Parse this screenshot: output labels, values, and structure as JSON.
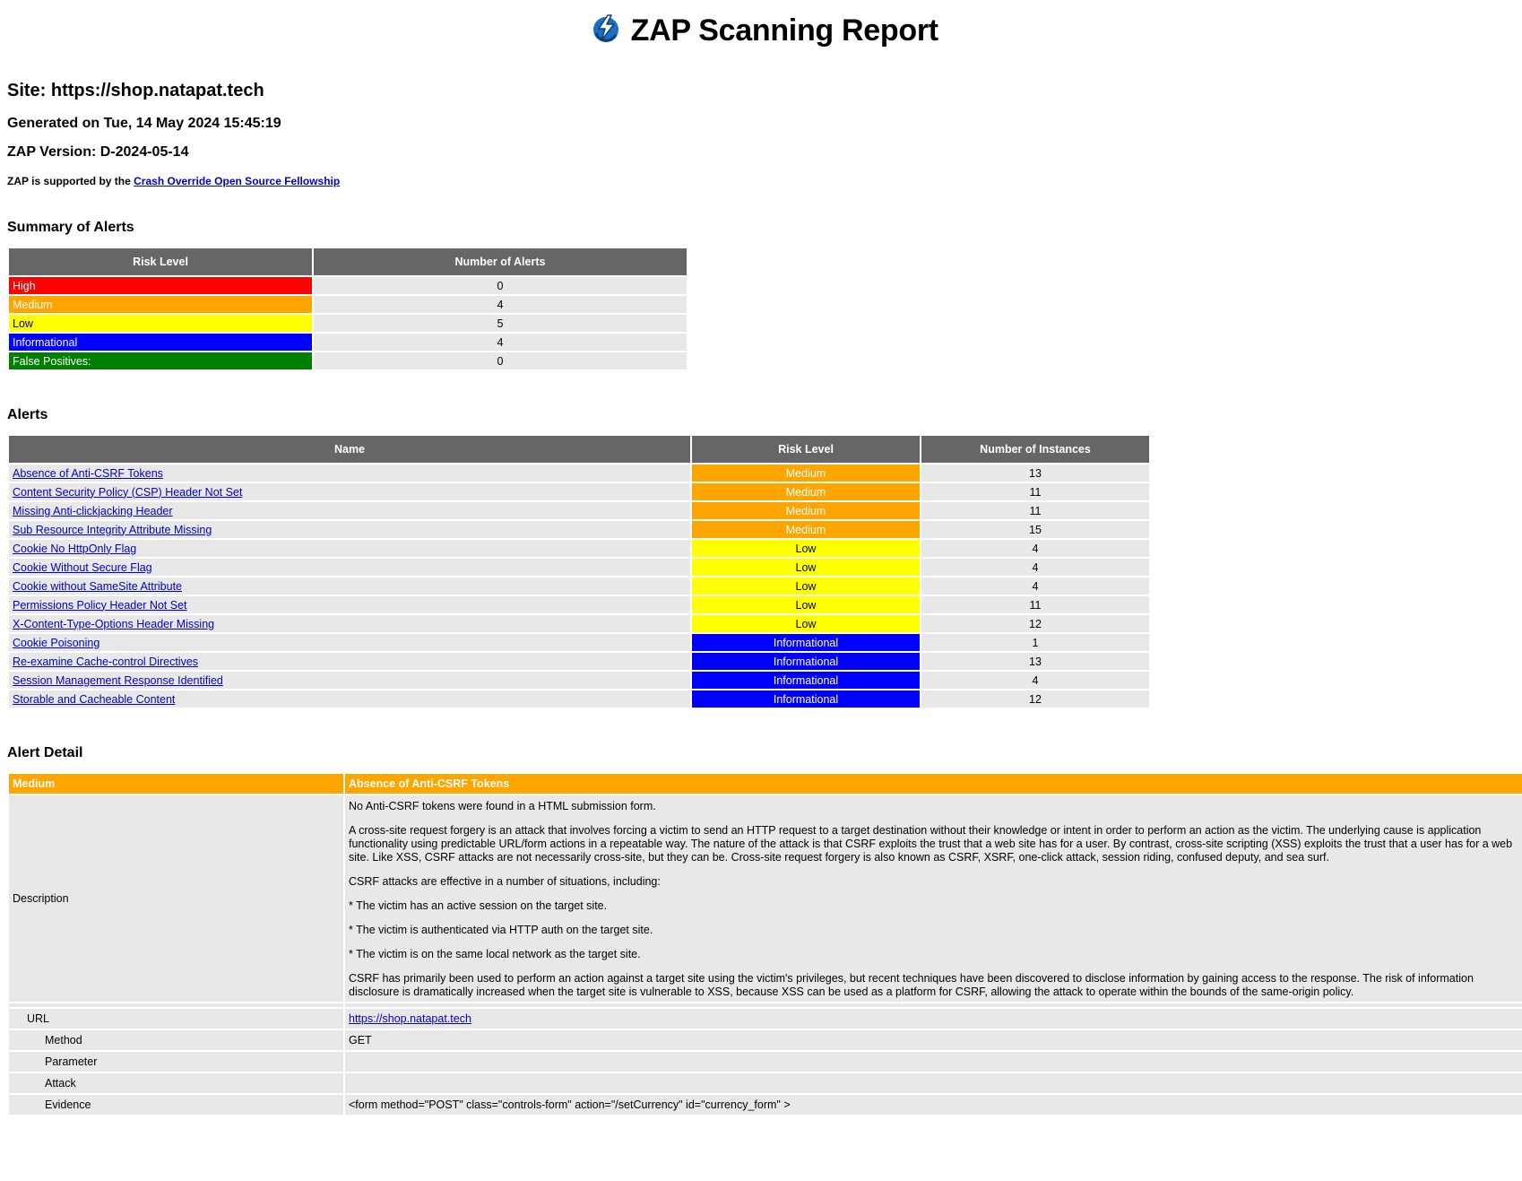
{
  "report": {
    "title": "ZAP Scanning Report",
    "site": "Site: https://shop.natapat.tech",
    "generated": "Generated on Tue, 14 May 2024 15:45:19",
    "version": "ZAP Version: D-2024-05-14",
    "support_prefix": "ZAP is supported by the",
    "support_link": "Crash Override Open Source Fellowship"
  },
  "colors": {
    "header_bg": "#666666",
    "cell_bg": "#e8e8e8",
    "high": "#ff0000",
    "medium": "#ffa500",
    "low": "#ffff00",
    "informational": "#0000ff",
    "false_positive": "#008000",
    "link": "#0000cc"
  },
  "summary": {
    "heading": "Summary of Alerts",
    "col_risk": "Risk Level",
    "col_count": "Number of Alerts",
    "rows": [
      {
        "risk": "High",
        "count": "0",
        "cls": "r-high"
      },
      {
        "risk": "Medium",
        "count": "4",
        "cls": "r-medium"
      },
      {
        "risk": "Low",
        "count": "5",
        "cls": "r-low"
      },
      {
        "risk": "Informational",
        "count": "4",
        "cls": "r-info"
      },
      {
        "risk": "False Positives:",
        "count": "0",
        "cls": "r-fp"
      }
    ]
  },
  "alerts": {
    "heading": "Alerts",
    "col_name": "Name",
    "col_risk": "Risk Level",
    "col_instances": "Number of Instances",
    "rows": [
      {
        "name": "Absence of Anti-CSRF Tokens",
        "risk": "Medium",
        "instances": "13",
        "cls": "r-medium"
      },
      {
        "name": "Content Security Policy (CSP) Header Not Set",
        "risk": "Medium",
        "instances": "11",
        "cls": "r-medium"
      },
      {
        "name": "Missing Anti-clickjacking Header",
        "risk": "Medium",
        "instances": "11",
        "cls": "r-medium"
      },
      {
        "name": "Sub Resource Integrity Attribute Missing",
        "risk": "Medium",
        "instances": "15",
        "cls": "r-medium"
      },
      {
        "name": "Cookie No HttpOnly Flag",
        "risk": "Low",
        "instances": "4",
        "cls": "r-low"
      },
      {
        "name": "Cookie Without Secure Flag",
        "risk": "Low",
        "instances": "4",
        "cls": "r-low"
      },
      {
        "name": "Cookie without SameSite Attribute",
        "risk": "Low",
        "instances": "4",
        "cls": "r-low"
      },
      {
        "name": "Permissions Policy Header Not Set",
        "risk": "Low",
        "instances": "11",
        "cls": "r-low"
      },
      {
        "name": "X-Content-Type-Options Header Missing",
        "risk": "Low",
        "instances": "12",
        "cls": "r-low"
      },
      {
        "name": "Cookie Poisoning",
        "risk": "Informational",
        "instances": "1",
        "cls": "r-info"
      },
      {
        "name": "Re-examine Cache-control Directives",
        "risk": "Informational",
        "instances": "13",
        "cls": "r-info"
      },
      {
        "name": "Session Management Response Identified",
        "risk": "Informational",
        "instances": "4",
        "cls": "r-info"
      },
      {
        "name": "Storable and Cacheable Content",
        "risk": "Informational",
        "instances": "12",
        "cls": "r-info"
      }
    ]
  },
  "detail": {
    "heading": "Alert Detail",
    "risk": "Medium",
    "title": "Absence of Anti-CSRF Tokens",
    "description_label": "Description",
    "description": [
      "No Anti-CSRF tokens were found in a HTML submission form.",
      "A cross-site request forgery is an attack that involves forcing a victim to send an HTTP request to a target destination without their knowledge or intent in order to perform an action as the victim. The underlying cause is application functionality using predictable URL/form actions in a repeatable way. The nature of the attack is that CSRF exploits the trust that a web site has for a user. By contrast, cross-site scripting (XSS) exploits the trust that a user has for a web site. Like XSS, CSRF attacks are not necessarily cross-site, but they can be. Cross-site request forgery is also known as CSRF, XSRF, one-click attack, session riding, confused deputy, and sea surf.",
      "CSRF attacks are effective in a number of situations, including:",
      "* The victim has an active session on the target site.",
      "* The victim is authenticated via HTTP auth on the target site.",
      "* The victim is on the same local network as the target site.",
      "CSRF has primarily been used to perform an action against a target site using the victim's privileges, but recent techniques have been discovered to disclose information by gaining access to the response. The risk of information disclosure is dramatically increased when the target site is vulnerable to XSS, because XSS can be used as a platform for CSRF, allowing the attack to operate within the bounds of the same-origin policy."
    ],
    "url_label": "URL",
    "url": "https://shop.natapat.tech",
    "method_label": "Method",
    "method": "GET",
    "parameter_label": "Parameter",
    "parameter": "",
    "attack_label": "Attack",
    "attack": "",
    "evidence_label": "Evidence",
    "evidence": "<form method=\"POST\" class=\"controls-form\" action=\"/setCurrency\" id=\"currency_form\" >"
  }
}
